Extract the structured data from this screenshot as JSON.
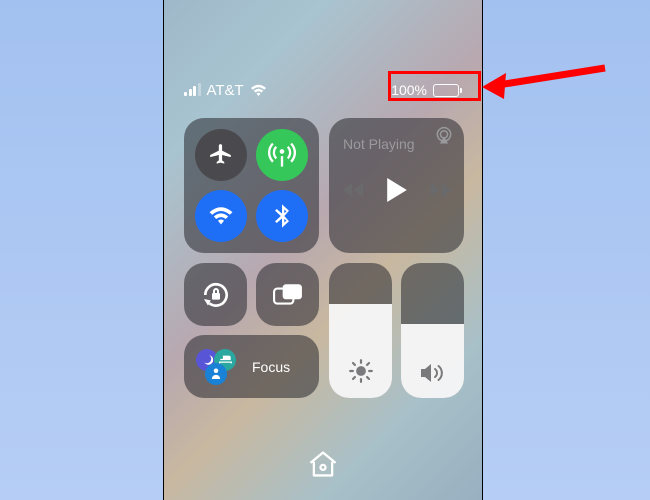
{
  "status": {
    "carrier": "AT&T",
    "signal_bars_filled": 3,
    "signal_bars_total": 4,
    "battery_text": "100%",
    "battery_fill_pct": 100
  },
  "connectivity": {
    "airplane_icon": "airplane-icon",
    "cellular_icon": "antenna-icon",
    "wifi_icon": "wifi-icon",
    "bluetooth_icon": "bluetooth-icon",
    "airplane_on": false,
    "cellular_on": true,
    "wifi_on": true,
    "bluetooth_on": true
  },
  "media": {
    "title": "Not Playing",
    "airplay_icon": "airplay-icon"
  },
  "tiles": {
    "orientation_icon": "orientation-lock-icon",
    "mirror_icon": "screen-mirroring-icon",
    "focus_label": "Focus",
    "focus_moon_icon": "moon-icon",
    "focus_sleep_icon": "bed-icon",
    "focus_personal_icon": "person-icon"
  },
  "sliders": {
    "brightness_pct": 70,
    "volume_pct": 55,
    "brightness_icon": "sun-icon",
    "volume_icon": "speaker-icon"
  },
  "home_icon": "home-icon",
  "colors": {
    "green": "#35c759",
    "blue": "#1f6ef6",
    "purple": "#5856d6",
    "teal": "#2aa8a0",
    "blue2": "#1a82d6",
    "callout_red": "#f00"
  }
}
